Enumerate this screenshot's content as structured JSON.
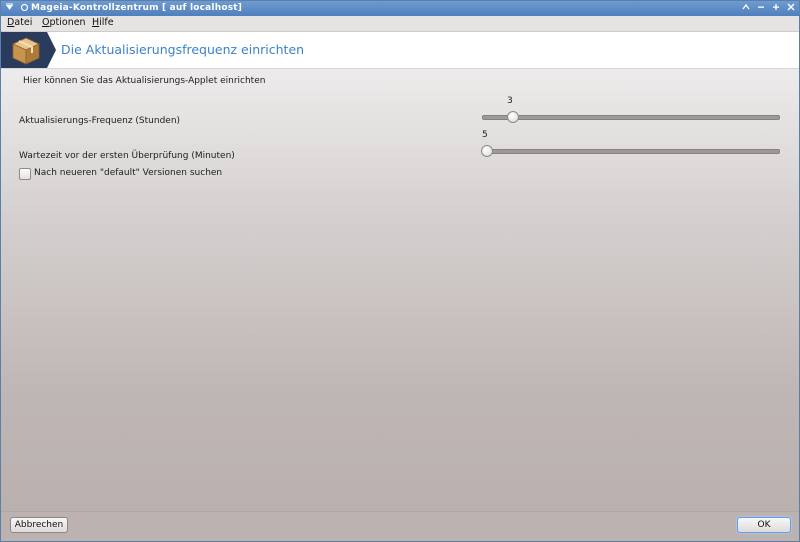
{
  "window": {
    "title": "Mageia-Kontrollzentrum  [ auf localhost]",
    "icons": [
      "menu-arrow-icon",
      "pin-icon",
      "minimize-icon",
      "restore-icon",
      "maximize-icon",
      "close-icon"
    ]
  },
  "menu": {
    "items": [
      {
        "first": "D",
        "rest": "atei"
      },
      {
        "first": "O",
        "rest": "ptionen"
      },
      {
        "first": "H",
        "rest": "ilfe"
      }
    ]
  },
  "header": {
    "title": "Die Aktualisierungsfrequenz einrichten",
    "icon": "package-box-icon"
  },
  "content": {
    "description": "Hier können Sie das Aktualisierungs-Applet einrichten",
    "frequency": {
      "label": "Aktualisierungs-Frequenz (Stunden)",
      "value": "3",
      "min": 1,
      "max": 24,
      "position_fraction": 0.09
    },
    "delay": {
      "label": "Wartezeit vor der ersten Überprüfung (Minuten)",
      "value": "5",
      "position_fraction": 0.0
    },
    "checkbox": {
      "label": "Nach neueren \"default\" Versionen suchen",
      "checked": false
    }
  },
  "buttons": {
    "cancel": "Abbrechen",
    "ok": "OK"
  },
  "colors": {
    "titlebar": "#4f7fbd",
    "header_title": "#3b82c8"
  }
}
